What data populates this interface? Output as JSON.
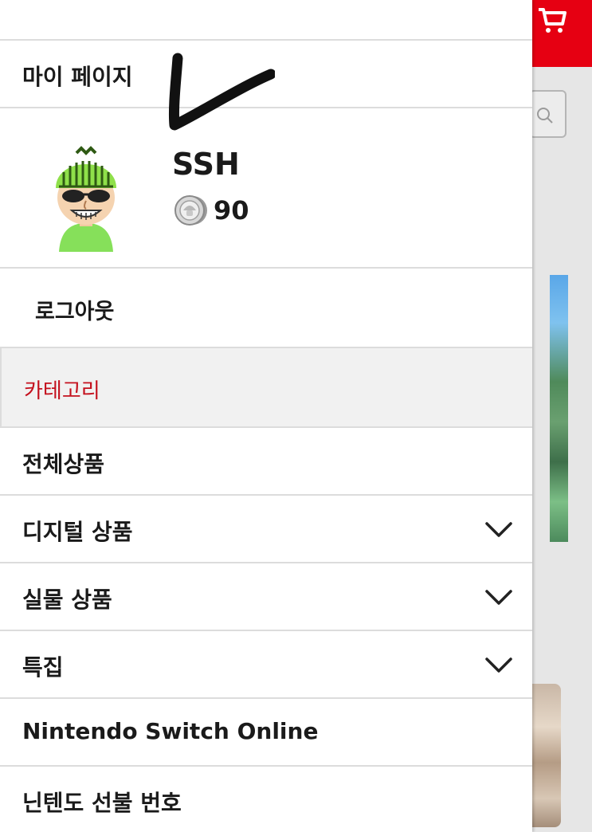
{
  "menu": {
    "my_page": "마이 페이지",
    "profile": {
      "username": "SSH",
      "points": "90"
    },
    "logout": "로그아웃",
    "category_header": "카테고리",
    "items": [
      {
        "label": "전체상품",
        "expandable": false
      },
      {
        "label": "디지털 상품",
        "expandable": true
      },
      {
        "label": "실물 상품",
        "expandable": true
      },
      {
        "label": "특집",
        "expandable": true
      },
      {
        "label": "Nintendo Switch Online",
        "expandable": false
      },
      {
        "label": "닌텐도 선불 번호",
        "expandable": false
      }
    ]
  },
  "icons": {
    "cart": "cart-icon",
    "search": "search-icon",
    "coin": "platinum-point-icon",
    "chevron": "chevron-down-icon",
    "avatar": "mii-avatar"
  },
  "colors": {
    "brand_red": "#e60012",
    "category_text": "#c4101d",
    "category_bg": "#f1f1f1"
  }
}
